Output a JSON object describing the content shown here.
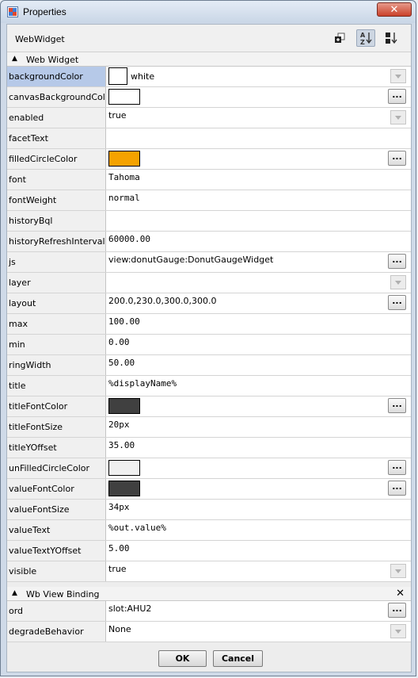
{
  "window": {
    "title": "Properties",
    "close_glyph": "✕"
  },
  "header": {
    "title": "WebWidget"
  },
  "sections": {
    "web_widget": "Web Widget",
    "wb_view_binding": "Wb View Binding"
  },
  "properties": [
    {
      "name": "backgroundColor",
      "value": "white",
      "kind": "swatch-dropdown",
      "color": "#ffffff"
    },
    {
      "name": "canvasBackgroundColor",
      "value": "",
      "kind": "color",
      "color": "#ffffff"
    },
    {
      "name": "enabled",
      "value": "true",
      "kind": "dropdown"
    },
    {
      "name": "facetText",
      "value": "",
      "kind": "text"
    },
    {
      "name": "filledCircleColor",
      "value": "",
      "kind": "color",
      "color": "#f5a200"
    },
    {
      "name": "font",
      "value": "Tahoma",
      "kind": "mono"
    },
    {
      "name": "fontWeight",
      "value": "normal",
      "kind": "mono"
    },
    {
      "name": "historyBql",
      "value": "",
      "kind": "text"
    },
    {
      "name": "historyRefreshInterval",
      "value": "60000.00",
      "kind": "mono"
    },
    {
      "name": "js",
      "value": "view:donutGauge:DonutGaugeWidget",
      "kind": "text-ellipsis"
    },
    {
      "name": "layer",
      "value": "",
      "kind": "dropdown"
    },
    {
      "name": "layout",
      "value": "200.0,230.0,300.0,300.0",
      "kind": "text-ellipsis"
    },
    {
      "name": "max",
      "value": "100.00",
      "kind": "mono"
    },
    {
      "name": "min",
      "value": "0.00",
      "kind": "mono"
    },
    {
      "name": "ringWidth",
      "value": "50.00",
      "kind": "mono"
    },
    {
      "name": "title",
      "value": "%displayName%",
      "kind": "mono"
    },
    {
      "name": "titleFontColor",
      "value": "",
      "kind": "color",
      "color": "#404040"
    },
    {
      "name": "titleFontSize",
      "value": "20px",
      "kind": "mono"
    },
    {
      "name": "titleYOffset",
      "value": "35.00",
      "kind": "mono"
    },
    {
      "name": "unFilledCircleColor",
      "value": "",
      "kind": "color",
      "color": "#f0f0f0"
    },
    {
      "name": "valueFontColor",
      "value": "",
      "kind": "color",
      "color": "#404040"
    },
    {
      "name": "valueFontSize",
      "value": "34px",
      "kind": "mono"
    },
    {
      "name": "valueText",
      "value": "%out.value%",
      "kind": "mono"
    },
    {
      "name": "valueTextYOffset",
      "value": "5.00",
      "kind": "mono"
    },
    {
      "name": "visible",
      "value": "true",
      "kind": "dropdown"
    }
  ],
  "binding": [
    {
      "name": "ord",
      "value": "slot:AHU2",
      "kind": "text-ellipsis"
    },
    {
      "name": "degradeBehavior",
      "value": "None",
      "kind": "dropdown"
    }
  ],
  "buttons": {
    "ok": "OK",
    "cancel": "Cancel",
    "ellipsis": "..."
  },
  "colors": {
    "selected_row": "#b6c9e8",
    "close_button": "#c9412a"
  }
}
